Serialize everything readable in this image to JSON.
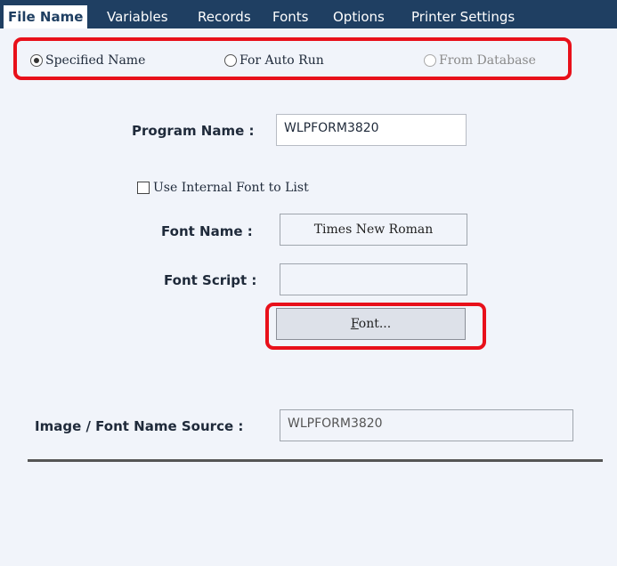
{
  "tabs": [
    {
      "label": "File Name",
      "active": true
    },
    {
      "label": "Variables",
      "active": false
    },
    {
      "label": "Records",
      "active": false
    },
    {
      "label": "Fonts",
      "active": false
    },
    {
      "label": "Options",
      "active": false
    },
    {
      "label": "Printer Settings",
      "active": false
    }
  ],
  "name_source": {
    "selected": "specified",
    "options": [
      {
        "label": "Specified Name",
        "checked": true,
        "enabled": true
      },
      {
        "label": "For Auto Run",
        "checked": false,
        "enabled": true
      },
      {
        "label": "From Database",
        "checked": false,
        "enabled": false
      }
    ]
  },
  "program_name": {
    "label": "Program Name :",
    "value": "WLPFORM3820"
  },
  "internal_font": {
    "label": "Use Internal Font to List",
    "checked": false
  },
  "font_name": {
    "label": "Font Name :",
    "value": "Times New Roman"
  },
  "font_script": {
    "label": "Font Script :",
    "value": ""
  },
  "font_button": {
    "label_mnemonic": "F",
    "label_rest": "ont..."
  },
  "image_source": {
    "label": "Image / Font Name Source :",
    "value": "WLPFORM3820"
  },
  "colors": {
    "tab_bar": "#1f3f62",
    "highlight": "#e8101a",
    "panel": "#f1f4fa"
  }
}
